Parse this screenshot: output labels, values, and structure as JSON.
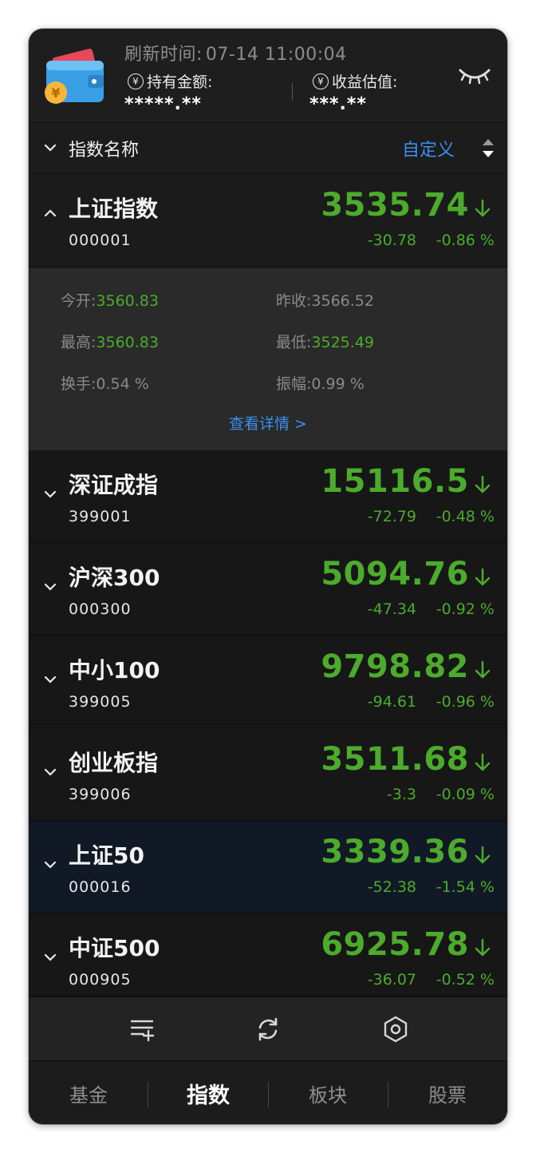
{
  "header": {
    "refresh_label": "刷新时间:",
    "refresh_time": "07-14 11:00:04",
    "holding_label": "持有金额:",
    "holding_value": "*****.**",
    "estimate_label": "收益估值:",
    "estimate_value": "***.**",
    "yen_symbol": "¥",
    "wallet_icon": "wallet-icon",
    "visibility_icon": "eye-closed-icon"
  },
  "list_header": {
    "title": "指数名称",
    "custom_label": "自定义",
    "sort_icon": "sort-icon"
  },
  "indices": [
    {
      "name": "上证指数",
      "code": "000001",
      "price": "3535.74",
      "change": "-30.78",
      "percent": "-0.86 %",
      "expanded": true
    },
    {
      "name": "深证成指",
      "code": "399001",
      "price": "15116.5",
      "change": "-72.79",
      "percent": "-0.48 %"
    },
    {
      "name": "沪深300",
      "code": "000300",
      "price": "5094.76",
      "change": "-47.34",
      "percent": "-0.92 %"
    },
    {
      "name": "中小100",
      "code": "399005",
      "price": "9798.82",
      "change": "-94.61",
      "percent": "-0.96 %"
    },
    {
      "name": "创业板指",
      "code": "399006",
      "price": "3511.68",
      "change": "-3.3",
      "percent": "-0.09 %"
    },
    {
      "name": "上证50",
      "code": "000016",
      "price": "3339.36",
      "change": "-52.38",
      "percent": "-1.54 %",
      "selected": true
    },
    {
      "name": "中证500",
      "code": "000905",
      "price": "6925.78",
      "change": "-36.07",
      "percent": "-0.52 %"
    }
  ],
  "detail": {
    "open_label": "今开:",
    "open_value": "3560.83",
    "prev_close_label": "昨收:",
    "prev_close_value": "3566.52",
    "high_label": "最高:",
    "high_value": "3560.83",
    "low_label": "最低:",
    "low_value": "3525.49",
    "turnover_label": "换手:",
    "turnover_value": "0.54 %",
    "amplitude_label": "振幅:",
    "amplitude_value": "0.99 %",
    "more_label": "查看详情 >"
  },
  "toolbar": {
    "icons": [
      "list-add-icon",
      "refresh-icon",
      "settings-icon"
    ]
  },
  "tabs": [
    {
      "label": "基金",
      "active": false
    },
    {
      "label": "指数",
      "active": true
    },
    {
      "label": "板块",
      "active": false
    },
    {
      "label": "股票",
      "active": false
    }
  ],
  "colors": {
    "down_green": "#4cab2c",
    "accent_blue": "#3a8ff0",
    "background": "#1b1b1b",
    "selected_row": "#111926"
  }
}
